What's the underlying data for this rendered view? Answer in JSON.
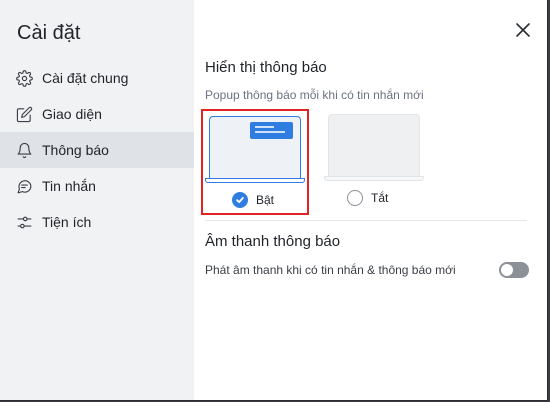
{
  "sidebar": {
    "title": "Cài đặt",
    "items": [
      {
        "label": "Cài đặt chung",
        "icon": "gear-icon"
      },
      {
        "label": "Giao diện",
        "icon": "edit-icon"
      },
      {
        "label": "Thông báo",
        "icon": "bell-icon",
        "active": true
      },
      {
        "label": "Tin nhắn",
        "icon": "chat-icon"
      },
      {
        "label": "Tiện ích",
        "icon": "sliders-icon"
      }
    ]
  },
  "notifications": {
    "title": "Hiển thị thông báo",
    "subtitle": "Popup thông báo mỗi khi có tin nhắn mới",
    "options": [
      {
        "label": "Bật",
        "selected": true
      },
      {
        "label": "Tắt",
        "selected": false
      }
    ]
  },
  "sound": {
    "title": "Âm thanh thông báo",
    "label": "Phát âm thanh khi có tin nhắn & thông báo mới",
    "enabled": false
  },
  "colors": {
    "accent": "#2f7de1",
    "highlight_border": "#e02424",
    "sidebar_bg": "#f1f2f4",
    "active_item_bg": "#dfe2e6"
  }
}
